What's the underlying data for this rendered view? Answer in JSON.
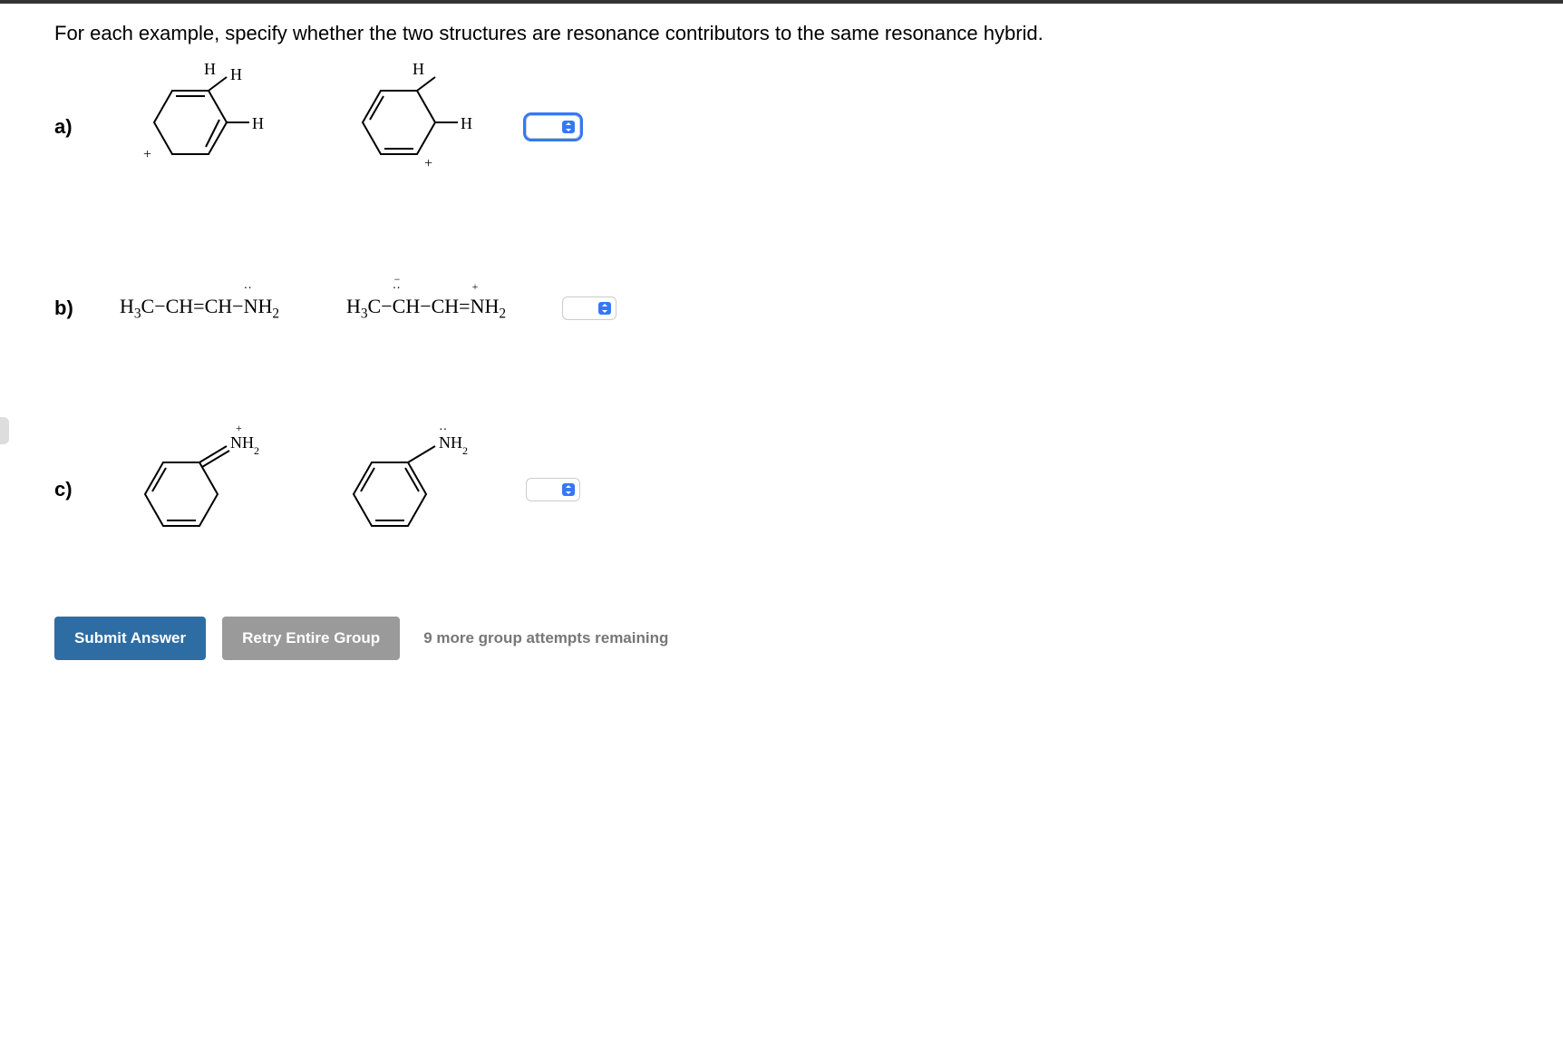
{
  "prompt": "For each example, specify whether the two structures are resonance contributors to the same resonance hybrid.",
  "questions": {
    "a": {
      "label": "a)",
      "structure1_desc": "cyclohexadienyl cation with H substituents (1,2-addition pattern, + at meta)",
      "structure2_desc": "cyclohexadienyl cation with H substituents (alternate double bond pattern, + at ortho)"
    },
    "b": {
      "label": "b)",
      "structure1_text": "H₃C−CH=CH−N̈H₂",
      "structure2_text": "H₃C−C̄H−CH=N⁺H₂"
    },
    "c": {
      "label": "c)",
      "structure1_desc": "cyclohexadienyl with =N⁺H₂ (iminium)",
      "structure2_desc": "cyclohexadienyl with −N̈H₂ (amine)"
    }
  },
  "buttons": {
    "submit": "Submit Answer",
    "retry": "Retry Entire Group"
  },
  "attempts_text": "9 more group attempts remaining"
}
